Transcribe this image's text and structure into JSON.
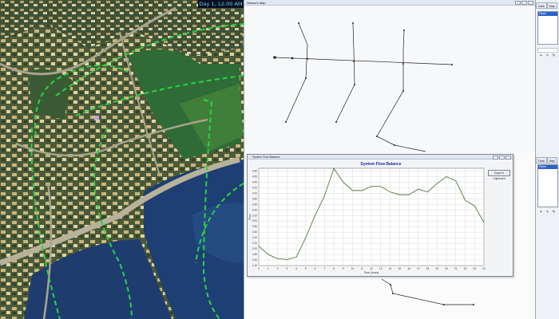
{
  "overlay": {
    "time": "Day 1, 12:00 AM"
  },
  "network_window": {
    "title": "Network Map"
  },
  "browser": {
    "tabs": [
      "Data",
      "Map"
    ],
    "selected_item": "Pipes"
  },
  "flow_chart": {
    "window_title": "System Flow Balance",
    "copy_label": "Copy to Clipboard"
  },
  "chart_data": {
    "type": "line",
    "title": "System Flow Balance",
    "xlabel": "Time (hours)",
    "ylabel": "Flow",
    "x": [
      0,
      1,
      2,
      3,
      4,
      5,
      6,
      7,
      8,
      9,
      10,
      11,
      12,
      13,
      14,
      15,
      16,
      17,
      18,
      19,
      20,
      21,
      22,
      23,
      24
    ],
    "series": [
      {
        "values": [
          2.1,
          1.8,
          1.65,
          1.62,
          1.7,
          2.4,
          3.2,
          3.9,
          4.9,
          4.4,
          4.1,
          4.1,
          4.25,
          4.25,
          4.05,
          3.95,
          3.95,
          4.15,
          4.05,
          4.35,
          4.6,
          4.45,
          3.75,
          3.55,
          2.95
        ]
      }
    ],
    "xlim": [
      0,
      24
    ],
    "ylim": [
      1.4,
      4.9
    ],
    "yticks": [
      1.4,
      1.6,
      1.8,
      2.0,
      2.2,
      2.4,
      2.6,
      2.8,
      3.0,
      3.2,
      3.4,
      3.6,
      3.8,
      4.0,
      4.2,
      4.4,
      4.6,
      4.8
    ],
    "grid": true,
    "line_color": "#4e7b3a"
  }
}
